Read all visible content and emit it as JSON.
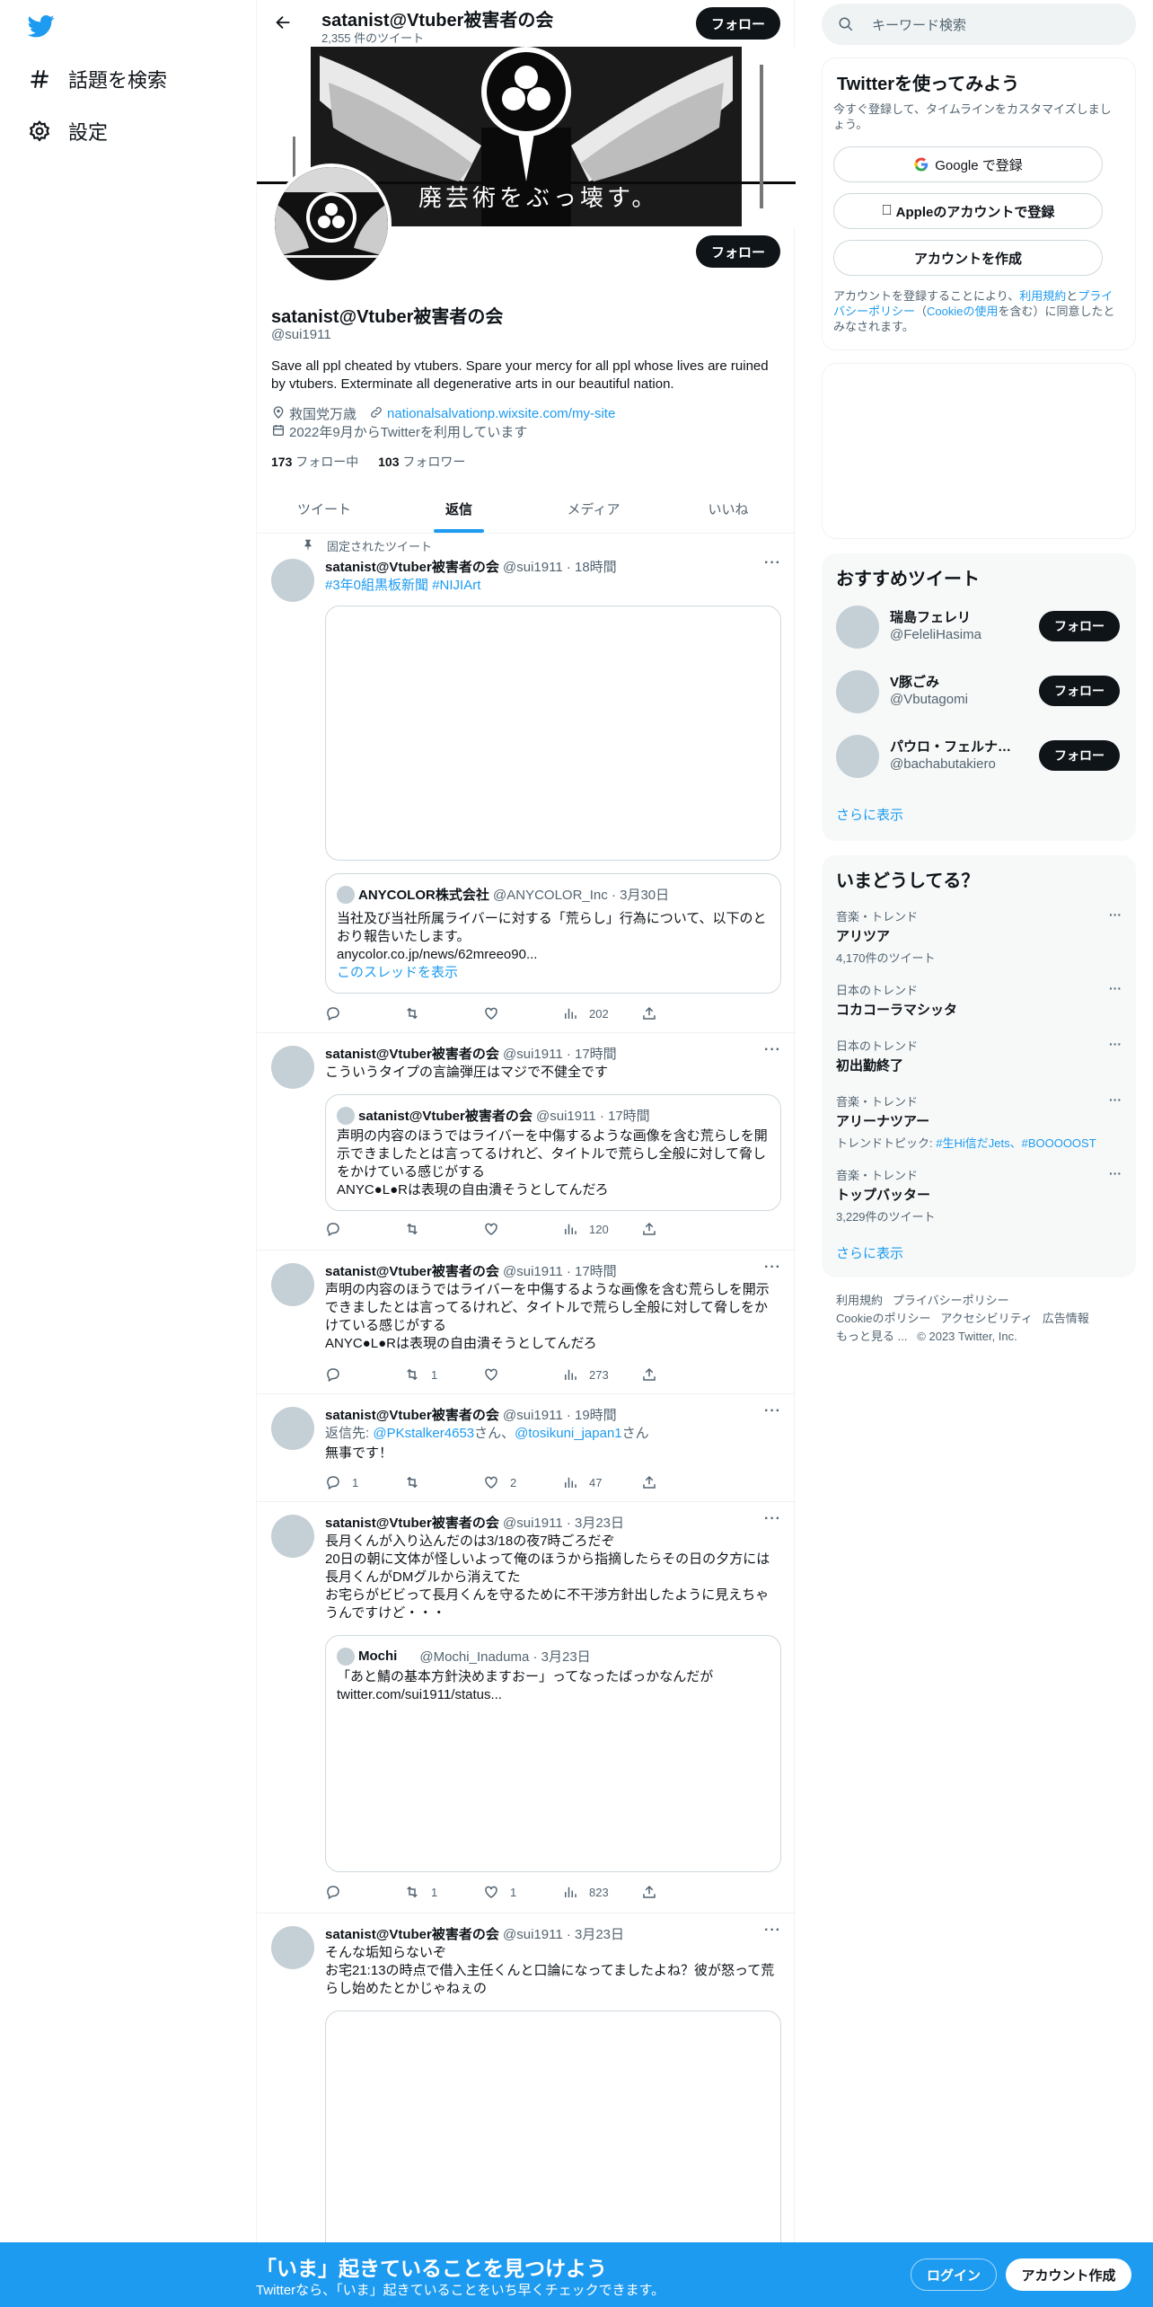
{
  "nav": {
    "explore": "話題を検索",
    "settings": "設定"
  },
  "header": {
    "name": "satanist@Vtuber被害者の会",
    "tweet_count": "2,355 件のツイート",
    "follow_label": "フォロー"
  },
  "banner": {
    "text": "廃芸術をぶっ壊す。"
  },
  "profile": {
    "follow_label": "フォロー",
    "name": "satanist@Vtuber被害者の会",
    "handle": "@sui1911",
    "bio": "Save all ppl cheated by vtubers. Spare your mercy for all ppl whose lives are ruined by vtubers. Exterminate all degenerative arts in our beautiful nation.",
    "location": "救国党万歳",
    "website": "nationalsalvationp.wixsite.com/my-site",
    "joined": "2022年9月からTwitterを利用しています",
    "following_count": "173",
    "following_label": "フォロー中",
    "followers_count": "103",
    "followers_label": "フォロワー"
  },
  "tabs": [
    "ツイート",
    "返信",
    "メディア",
    "いいね"
  ],
  "pinned_label": "固定されたツイート",
  "tweets": [
    {
      "name": "satanist@Vtuber被害者の会",
      "meta": "@sui1911 · 18時間",
      "text": "#3年0組黒板新聞 #NIJIArt",
      "quote_name": "ANYCOLOR株式会社",
      "quote_meta": "@ANYCOLOR_Inc · 3月30日",
      "quote_text": "当社及び当社所属ライバーに対する「荒らし」行為について、以下のとおり報告いたします。",
      "quote_link": "anycolor.co.jp/news/62mreeo90...",
      "quote_thread": "このスレッドを表示",
      "reply": "",
      "retweet": "",
      "like": "",
      "views": "202"
    },
    {
      "name": "satanist@Vtuber被害者の会",
      "meta": "@sui1911 · 17時間",
      "text": "こういうタイプの言論弾圧はマジで不健全です",
      "quote_name": "satanist@Vtuber被害者の会",
      "quote_meta": "@sui1911 · 17時間",
      "quote_text": "声明の内容のほうではライバーを中傷するような画像を含む荒らしを開示できましたとは言ってるけれど、タイトルで荒らし全般に対して脅しをかけている感じがする\nANYC●L●Rは表現の自由潰そうとしてんだろ",
      "reply": "",
      "retweet": "",
      "like": "",
      "views": "120"
    },
    {
      "name": "satanist@Vtuber被害者の会",
      "meta": "@sui1911 · 17時間",
      "text": "声明の内容のほうではライバーを中傷するような画像を含む荒らしを開示できましたとは言ってるけれど、タイトルで荒らし全般に対して脅しをかけている感じがする\nANYC●L●Rは表現の自由潰そうとしてんだろ",
      "reply": "",
      "retweet": "1",
      "like": "",
      "views": "273"
    },
    {
      "name": "satanist@Vtuber被害者の会",
      "meta": "@sui1911 · 19時間",
      "reply_to_prefix": "返信先: ",
      "reply_to_1": "@PKstalker4653",
      "reply_to_mid": "さん、",
      "reply_to_2": "@tosikuni_japan1",
      "reply_to_suffix": "さん",
      "text": "無事です！",
      "reply": "1",
      "retweet": "",
      "like": "2",
      "views": "47"
    },
    {
      "name": "satanist@Vtuber被害者の会",
      "meta": "@sui1911 · 3月23日",
      "text": "長月くんが入り込んだのは3/18の夜7時ごろだぞ\n20日の朝に文体が怪しいよって俺のほうから指摘したらその日の夕方には長月くんがDMグルから消えてた\nお宅らがビビって長月くんを守るために不干渉方針出したように見えちゃうんですけど・・・",
      "quote_name": "Mochi",
      "quote_meta": "@Mochi_Inaduma · 3月23日",
      "quote_text": "「あと鯖の基本方針決めますおー」ってなったばっかなんだが\ntwitter.com/sui1911/status...",
      "reply": "",
      "retweet": "1",
      "like": "1",
      "views": "823"
    },
    {
      "name": "satanist@Vtuber被害者の会",
      "meta": "@sui1911 · 3月23日",
      "text": "そんな垢知らないぞ\nお宅21:13の時点で借入主任くんと口論になってましたよね？彼が怒って荒らし始めたとかじゃねぇの"
    }
  ],
  "search": {
    "placeholder": "キーワード検索"
  },
  "signup": {
    "title": "Twitterを使ってみよう",
    "subtitle": "今すぐ登録して、タイムラインをカスタマイズしましょう。",
    "google": "Google で登録",
    "apple": "Appleのアカウントで登録",
    "create": "アカウントを作成",
    "terms_1": "アカウントを登録することにより、",
    "terms_link1": "利用規約",
    "terms_2": "と",
    "terms_link2": "プライバシーポリシー",
    "terms_3": "（",
    "terms_link3": "Cookieの使用",
    "terms_4": "を含む）に同意したとみなされます。"
  },
  "recommend": {
    "title": "おすすめツイート",
    "users": [
      {
        "name": "瑞島フェレリ",
        "handle": "@FeleliHasima",
        "follow": "フォロー"
      },
      {
        "name": "V豚ごみ",
        "handle": "@Vbutagomi",
        "follow": "フォロー"
      },
      {
        "name": "パウロ・フェルナンデス・豚...",
        "handle": "@bachabutakiero",
        "follow": "フォロー"
      }
    ],
    "show_more": "さらに表示"
  },
  "trends": {
    "title": "いまどうしてる？",
    "items": [
      {
        "cat": "音楽・トレンド",
        "title": "アリツア",
        "sub": "4,170件のツイート"
      },
      {
        "cat": "日本のトレンド",
        "title": "コカコーラマシッタ",
        "sub": ""
      },
      {
        "cat": "日本のトレンド",
        "title": "初出勤終了",
        "sub": ""
      },
      {
        "cat": "音楽・トレンド",
        "title": "アリーナツアー",
        "sub_prefix": "トレンドトピック: ",
        "sub_link": "#生Hi信だJets、#BOOOOOST"
      },
      {
        "cat": "音楽・トレンド",
        "title": "トップバッター",
        "sub": "3,229件のツイート"
      }
    ],
    "show_more": "さらに表示"
  },
  "footer": {
    "line1": [
      "利用規約",
      "プライバシーポリシー"
    ],
    "line2": [
      "Cookieのポリシー",
      "アクセシビリティ",
      "広告情報"
    ],
    "line3": [
      "もっと見る ...",
      "© 2023 Twitter, Inc."
    ]
  },
  "bottom": {
    "title": "「いま」起きていることを見つけよう",
    "subtitle": "Twitterなら、「いま」起きていることをいち早くチェックできます。",
    "login": "ログイン",
    "signup": "アカウント作成"
  },
  "colors": {
    "accent": "#1d9bf0",
    "text": "#0f1419",
    "muted": "#536471"
  }
}
